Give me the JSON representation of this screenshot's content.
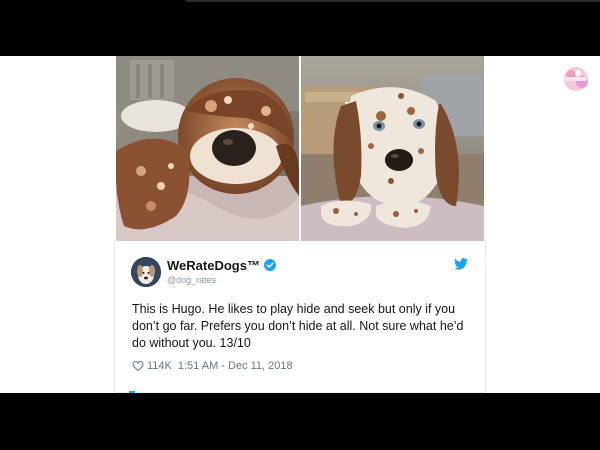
{
  "tweet": {
    "display_name": "WeRateDogs™",
    "handle": "@dog_rates",
    "text": "This is Hugo. He likes to play hide and seek but only if you don’t go far. Prefers you don’t hide at all. Not sure what he’d do without you. 13/10",
    "likes": "114K",
    "timestamp": "1:51 AM - Dec 11, 2018",
    "verified": true
  },
  "icons": {
    "verified": "verified-badge-icon",
    "brand": "twitter-bird-icon",
    "like": "heart-icon",
    "watermark": "channel-logo-icon"
  },
  "colors": {
    "twitter_blue": "#1da1f2",
    "text_primary": "#14171a",
    "text_secondary": "#657786",
    "letterbox": "#000000"
  }
}
